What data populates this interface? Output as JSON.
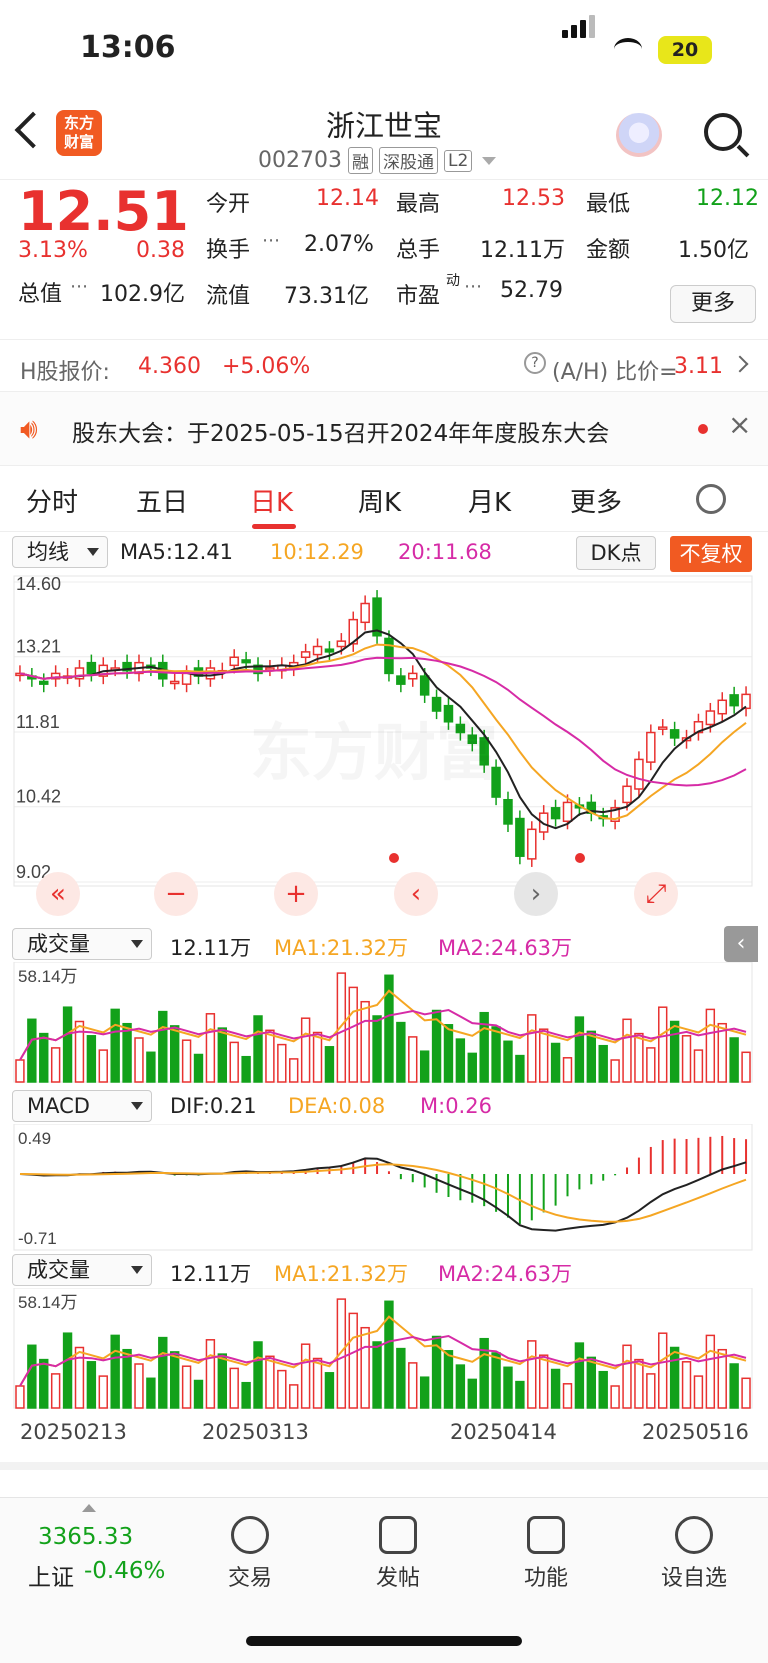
{
  "status": {
    "time": "13:06",
    "battery": "20"
  },
  "header": {
    "logo_text_1": "东方",
    "logo_text_2": "财富",
    "name": "浙江世宝",
    "code": "002703",
    "tags": [
      "融",
      "深股通",
      "L2"
    ]
  },
  "quote": {
    "price": "12.51",
    "pct": "3.13%",
    "change": "0.38",
    "open_label": "今开",
    "open": "12.14",
    "high_label": "最高",
    "high": "12.53",
    "low_label": "最低",
    "low": "12.12",
    "turnover_label": "换手",
    "turnover": "2.07%",
    "volume_label": "总手",
    "volume": "12.11万",
    "amount_label": "金额",
    "amount": "1.50亿",
    "mktcap_label": "总值",
    "mktcap": "102.9亿",
    "float_label": "流值",
    "float": "73.31亿",
    "pe_label": "市盈",
    "pe_sup": "动",
    "pe": "52.79",
    "more": "更多"
  },
  "hshare": {
    "label": "H股报价:",
    "price": "4.360",
    "pct": "+5.06%",
    "ratio_label": "(A/H) 比价=",
    "ratio": "3.11"
  },
  "notice": {
    "text": "股东大会：于2025-05-15召开2024年年度股东大会"
  },
  "tabs": [
    "分时",
    "五日",
    "日K",
    "周K",
    "月K",
    "更多"
  ],
  "kline": {
    "selector": "均线",
    "ma5": "MA5:12.41",
    "ma10": "10:12.29",
    "ma20": "20:11.68",
    "dk": "DK点",
    "fq": "不复权",
    "y_labels": [
      "14.60",
      "13.21",
      "11.81",
      "10.42",
      "9.02"
    ],
    "watermark": "东方财富"
  },
  "vol1": {
    "selector": "成交量",
    "vol": "12.11万",
    "ma1": "MA1:21.32万",
    "ma2": "MA2:24.63万",
    "top": "58.14万"
  },
  "macd": {
    "selector": "MACD",
    "dif": "DIF:0.21",
    "dea": "DEA:0.08",
    "m": "M:0.26",
    "top": "0.49",
    "bottom": "-0.71"
  },
  "vol2": {
    "selector": "成交量",
    "vol": "12.11万",
    "ma1": "MA1:21.32万",
    "ma2": "MA2:24.63万",
    "top": "58.14万"
  },
  "dates": [
    "20250213",
    "20250313",
    "20250414",
    "20250516"
  ],
  "toolbar": {
    "index_value": "3365.33",
    "index_name": "上证",
    "index_pct": "-0.46%",
    "items": [
      "交易",
      "发帖",
      "功能",
      "设自选"
    ]
  },
  "colors": {
    "up": "#e8312f",
    "down": "#12a11a",
    "ma5": "#222222",
    "ma10": "#f5a623",
    "ma20": "#d62ba6"
  }
}
